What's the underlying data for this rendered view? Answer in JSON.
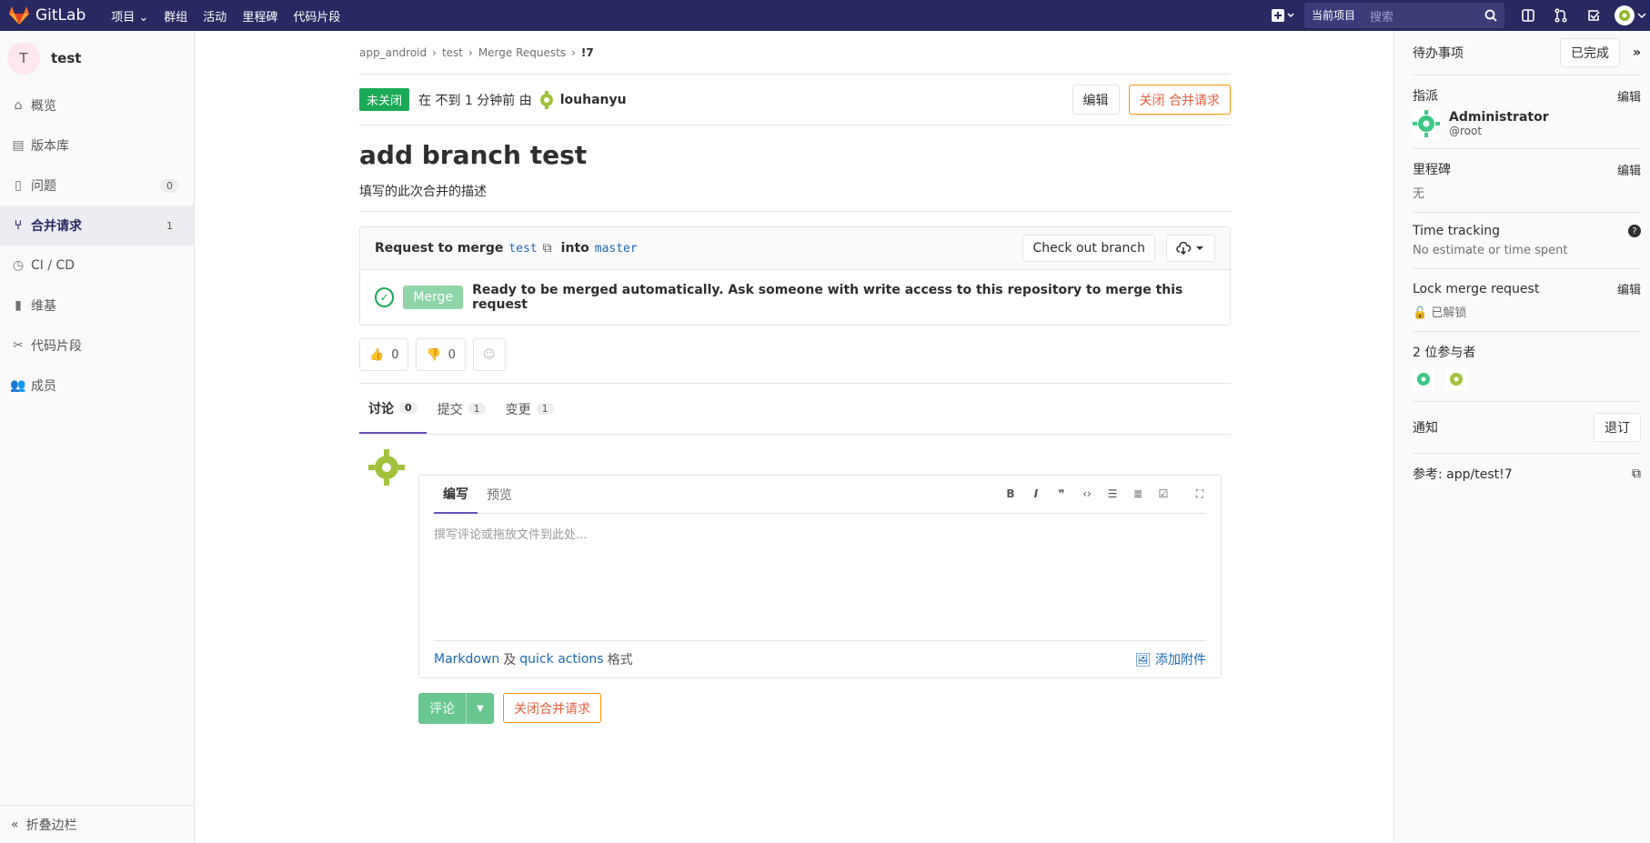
{
  "topbar": {
    "brand": "GitLab",
    "nav": [
      "项目 ⌄",
      "群组",
      "活动",
      "里程碑",
      "代码片段"
    ],
    "scope": "当前项目",
    "search_placeholder": "搜索"
  },
  "sidebar": {
    "project_initial": "T",
    "project_name": "test",
    "items": [
      {
        "label": "概览",
        "icon": "home-icon"
      },
      {
        "label": "版本库",
        "icon": "doc-icon"
      },
      {
        "label": "问题",
        "icon": "issues-icon",
        "count": "0"
      },
      {
        "label": "合并请求",
        "icon": "merge-request-icon",
        "count": "1"
      },
      {
        "label": "CI / CD",
        "icon": "rocket-icon"
      },
      {
        "label": "维基",
        "icon": "book-icon"
      },
      {
        "label": "代码片段",
        "icon": "scissors-icon"
      },
      {
        "label": "成员",
        "icon": "users-icon"
      }
    ],
    "collapse_label": "折叠边栏"
  },
  "breadcrumb": [
    "app_android",
    "test",
    "Merge Requests",
    "!7"
  ],
  "mr": {
    "status": "未关闭",
    "meta_prefix": "在 不到 1 分钟前 由",
    "author": "louhanyu",
    "edit_label": "编辑",
    "close_label": "关闭 合并请求",
    "title": "add branch test",
    "description": "填写的此次合并的描述"
  },
  "widget": {
    "prefix": "Request to merge",
    "source_branch": "test",
    "into": "into",
    "target_branch": "master",
    "checkout_label": "Check out branch",
    "merge_label": "Merge",
    "ready_text": "Ready to be merged automatically. Ask someone with write access to this repository to merge this request"
  },
  "awards": {
    "thumbs_up": "0",
    "thumbs_down": "0"
  },
  "tabs": [
    {
      "label": "讨论",
      "count": "0"
    },
    {
      "label": "提交",
      "count": "1"
    },
    {
      "label": "变更",
      "count": "1"
    }
  ],
  "editor": {
    "write_tab": "编写",
    "preview_tab": "预览",
    "placeholder": "撰写评论或拖放文件到此处...",
    "markdown_link": "Markdown",
    "and": "及",
    "quick_actions_link": "quick actions",
    "format": "格式",
    "attach": "添加附件",
    "comment_button": "评论",
    "close_button": "关闭合并请求"
  },
  "right": {
    "todo": "待办事项",
    "done": "已完成",
    "assignee_label": "指派",
    "edit": "编辑",
    "assignee_name": "Administrator",
    "assignee_user": "@root",
    "milestone_label": "里程碑",
    "milestone_value": "无",
    "time_label": "Time tracking",
    "time_value": "No estimate or time spent",
    "lock_label": "Lock merge request",
    "lock_value": "已解锁",
    "participants": "2 位参与者",
    "notify_label": "通知",
    "unsubscribe": "退订",
    "reference": "参考:  app/test!7"
  },
  "colors": {
    "topbar": "#292961",
    "open_status": "#1aaa55",
    "warning": "#fc9403",
    "link": "#1b69b6"
  }
}
